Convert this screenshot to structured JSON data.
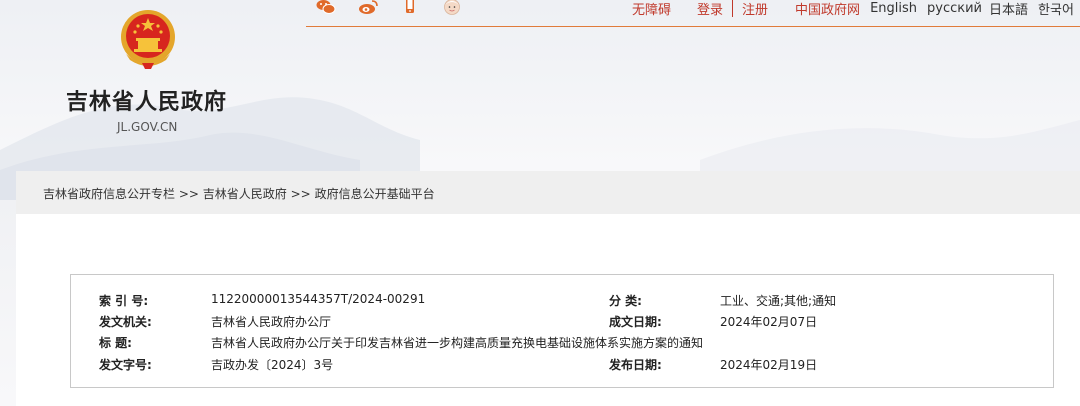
{
  "header": {
    "site_name": "吉林省人民政府",
    "site_domain": "JL.GOV.CN",
    "social_icons": [
      "wechat-icon",
      "weibo-icon",
      "mobile-icon",
      "elderly-mode-icon"
    ],
    "links": {
      "accessibility": "无障碍",
      "login": "登录",
      "register": "注册",
      "gov_portal": "中国政府网",
      "english": "English",
      "russian": "русский",
      "japanese": "日本語",
      "korean": "한국어"
    },
    "accent_color": "#c0392b",
    "rule_color": "#e07b3a"
  },
  "breadcrumb": {
    "items": [
      "吉林省政府信息公开专栏",
      "吉林省人民政府",
      "政府信息公开基础平台"
    ],
    "separator": ">>"
  },
  "document_info": {
    "index_label": "索 引 号:",
    "index_value": "11220000013544357T/2024-00291",
    "category_label": "分 类:",
    "category_value": "工业、交通;其他;通知",
    "issuer_label": "发文机关:",
    "issuer_value": "吉林省人民政府办公厅",
    "created_label": "成文日期:",
    "created_value": "2024年02月07日",
    "title_label": "标 题:",
    "title_value": "吉林省人民政府办公厅关于印发吉林省进一步构建高质量充换电基础设施体系实施方案的通知",
    "doc_number_label": "发文字号:",
    "doc_number_value": "吉政办发〔2024〕3号",
    "published_label": "发布日期:",
    "published_value": "2024年02月19日"
  }
}
